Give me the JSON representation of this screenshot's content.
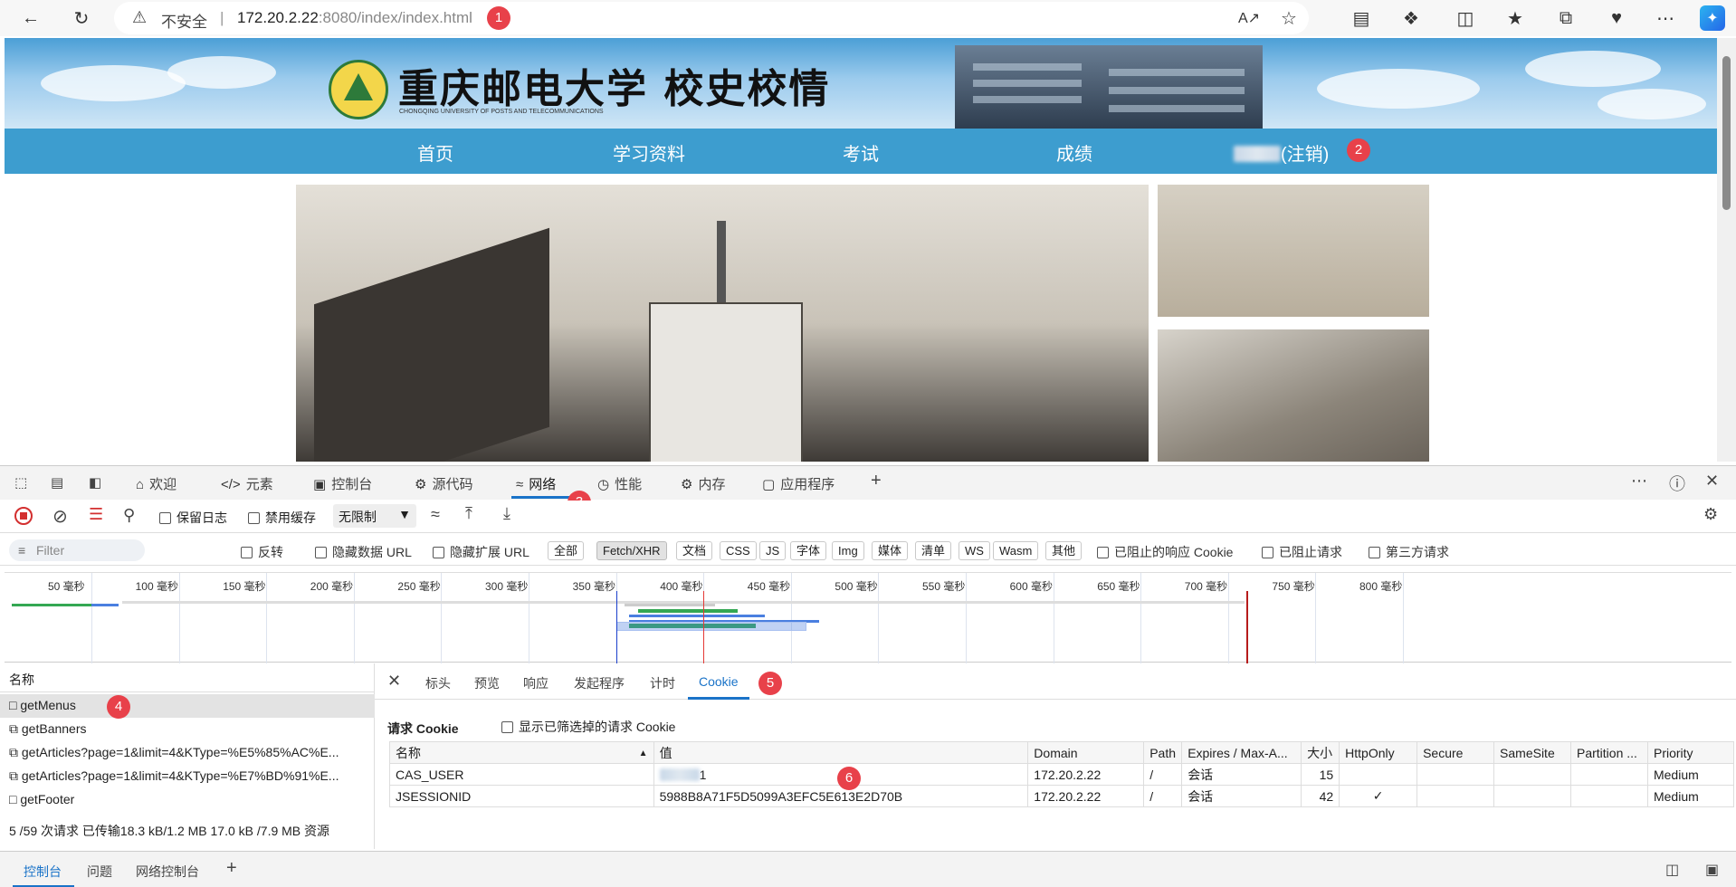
{
  "browser": {
    "security_label": "不安全",
    "separator": "|",
    "url_host": "172.20.2.22",
    "url_rest": ":8080/index/index.html"
  },
  "annotations": {
    "b1": "1",
    "b2": "2",
    "b3": "3",
    "b4": "4",
    "b5": "5",
    "b6": "6"
  },
  "site": {
    "school_name": "重庆邮电大学 校史校情",
    "school_en": "CHONGQING UNIVERSITY OF POSTS AND TELECOMMUNICATIONS",
    "nav": [
      "首页",
      "学习资料",
      "考试",
      "成绩"
    ],
    "logout": "(注销)"
  },
  "devtools": {
    "tabs": [
      "欢迎",
      "元素",
      "控制台",
      "源代码",
      "网络",
      "性能",
      "内存",
      "应用程序"
    ],
    "active_tab": "网络",
    "toolbar": {
      "preserve_log": "保留日志",
      "disable_cache": "禁用缓存",
      "throttle": "无限制"
    },
    "filter": {
      "placeholder": "Filter",
      "invert": "反转",
      "hide_data_url": "隐藏数据 URL",
      "hide_ext_url": "隐藏扩展 URL",
      "types": [
        "全部",
        "Fetch/XHR",
        "文档",
        "CSS",
        "JS",
        "字体",
        "Img",
        "媒体",
        "清单",
        "WS",
        "Wasm",
        "其他"
      ],
      "active_type": "Fetch/XHR",
      "blocked_cookies": "已阻止的响应 Cookie",
      "blocked_requests": "已阻止请求",
      "third_party": "第三方请求"
    },
    "timeline_ticks": [
      "50 毫秒",
      "100 毫秒",
      "150 毫秒",
      "200 毫秒",
      "250 毫秒",
      "300 毫秒",
      "350 毫秒",
      "400 毫秒",
      "450 毫秒",
      "500 毫秒",
      "550 毫秒",
      "600 毫秒",
      "650 毫秒",
      "700 毫秒",
      "750 毫秒",
      "800 毫秒"
    ],
    "requests_header": "名称",
    "requests": [
      "getMenus",
      "getBanners",
      "getArticles?page=1&limit=4&KType=%E5%85%AC%E...",
      "getArticles?page=1&limit=4&KType=%E7%BD%91%E...",
      "getFooter"
    ],
    "status": "5 /59 次请求  已传输18.3 kB/1.2 MB  17.0 kB /7.9 MB 资源",
    "detail_tabs": [
      "标头",
      "预览",
      "响应",
      "发起程序",
      "计时",
      "Cookie"
    ],
    "active_detail_tab": "Cookie",
    "cookie_section_title": "请求 Cookie",
    "show_filtered": "显示已筛选掉的请求 Cookie",
    "cookie_columns": [
      "名称",
      "值",
      "Domain",
      "Path",
      "Expires / Max-A...",
      "大小",
      "HttpOnly",
      "Secure",
      "SameSite",
      "Partition ...",
      "Priority"
    ],
    "cookies": [
      {
        "name": "CAS_USER",
        "value": "1",
        "domain": "172.20.2.22",
        "path": "/",
        "expires": "会话",
        "size": "15",
        "httponly": "",
        "secure": "",
        "samesite": "",
        "partition": "",
        "priority": "Medium"
      },
      {
        "name": "JSESSIONID",
        "value": "5988B8A71F5D5099A3EFC5E613E2D70B",
        "domain": "172.20.2.22",
        "path": "/",
        "expires": "会话",
        "size": "42",
        "httponly": "✓",
        "secure": "",
        "samesite": "",
        "partition": "",
        "priority": "Medium"
      }
    ],
    "drawer_tabs": [
      "控制台",
      "问题",
      "网络控制台"
    ]
  }
}
